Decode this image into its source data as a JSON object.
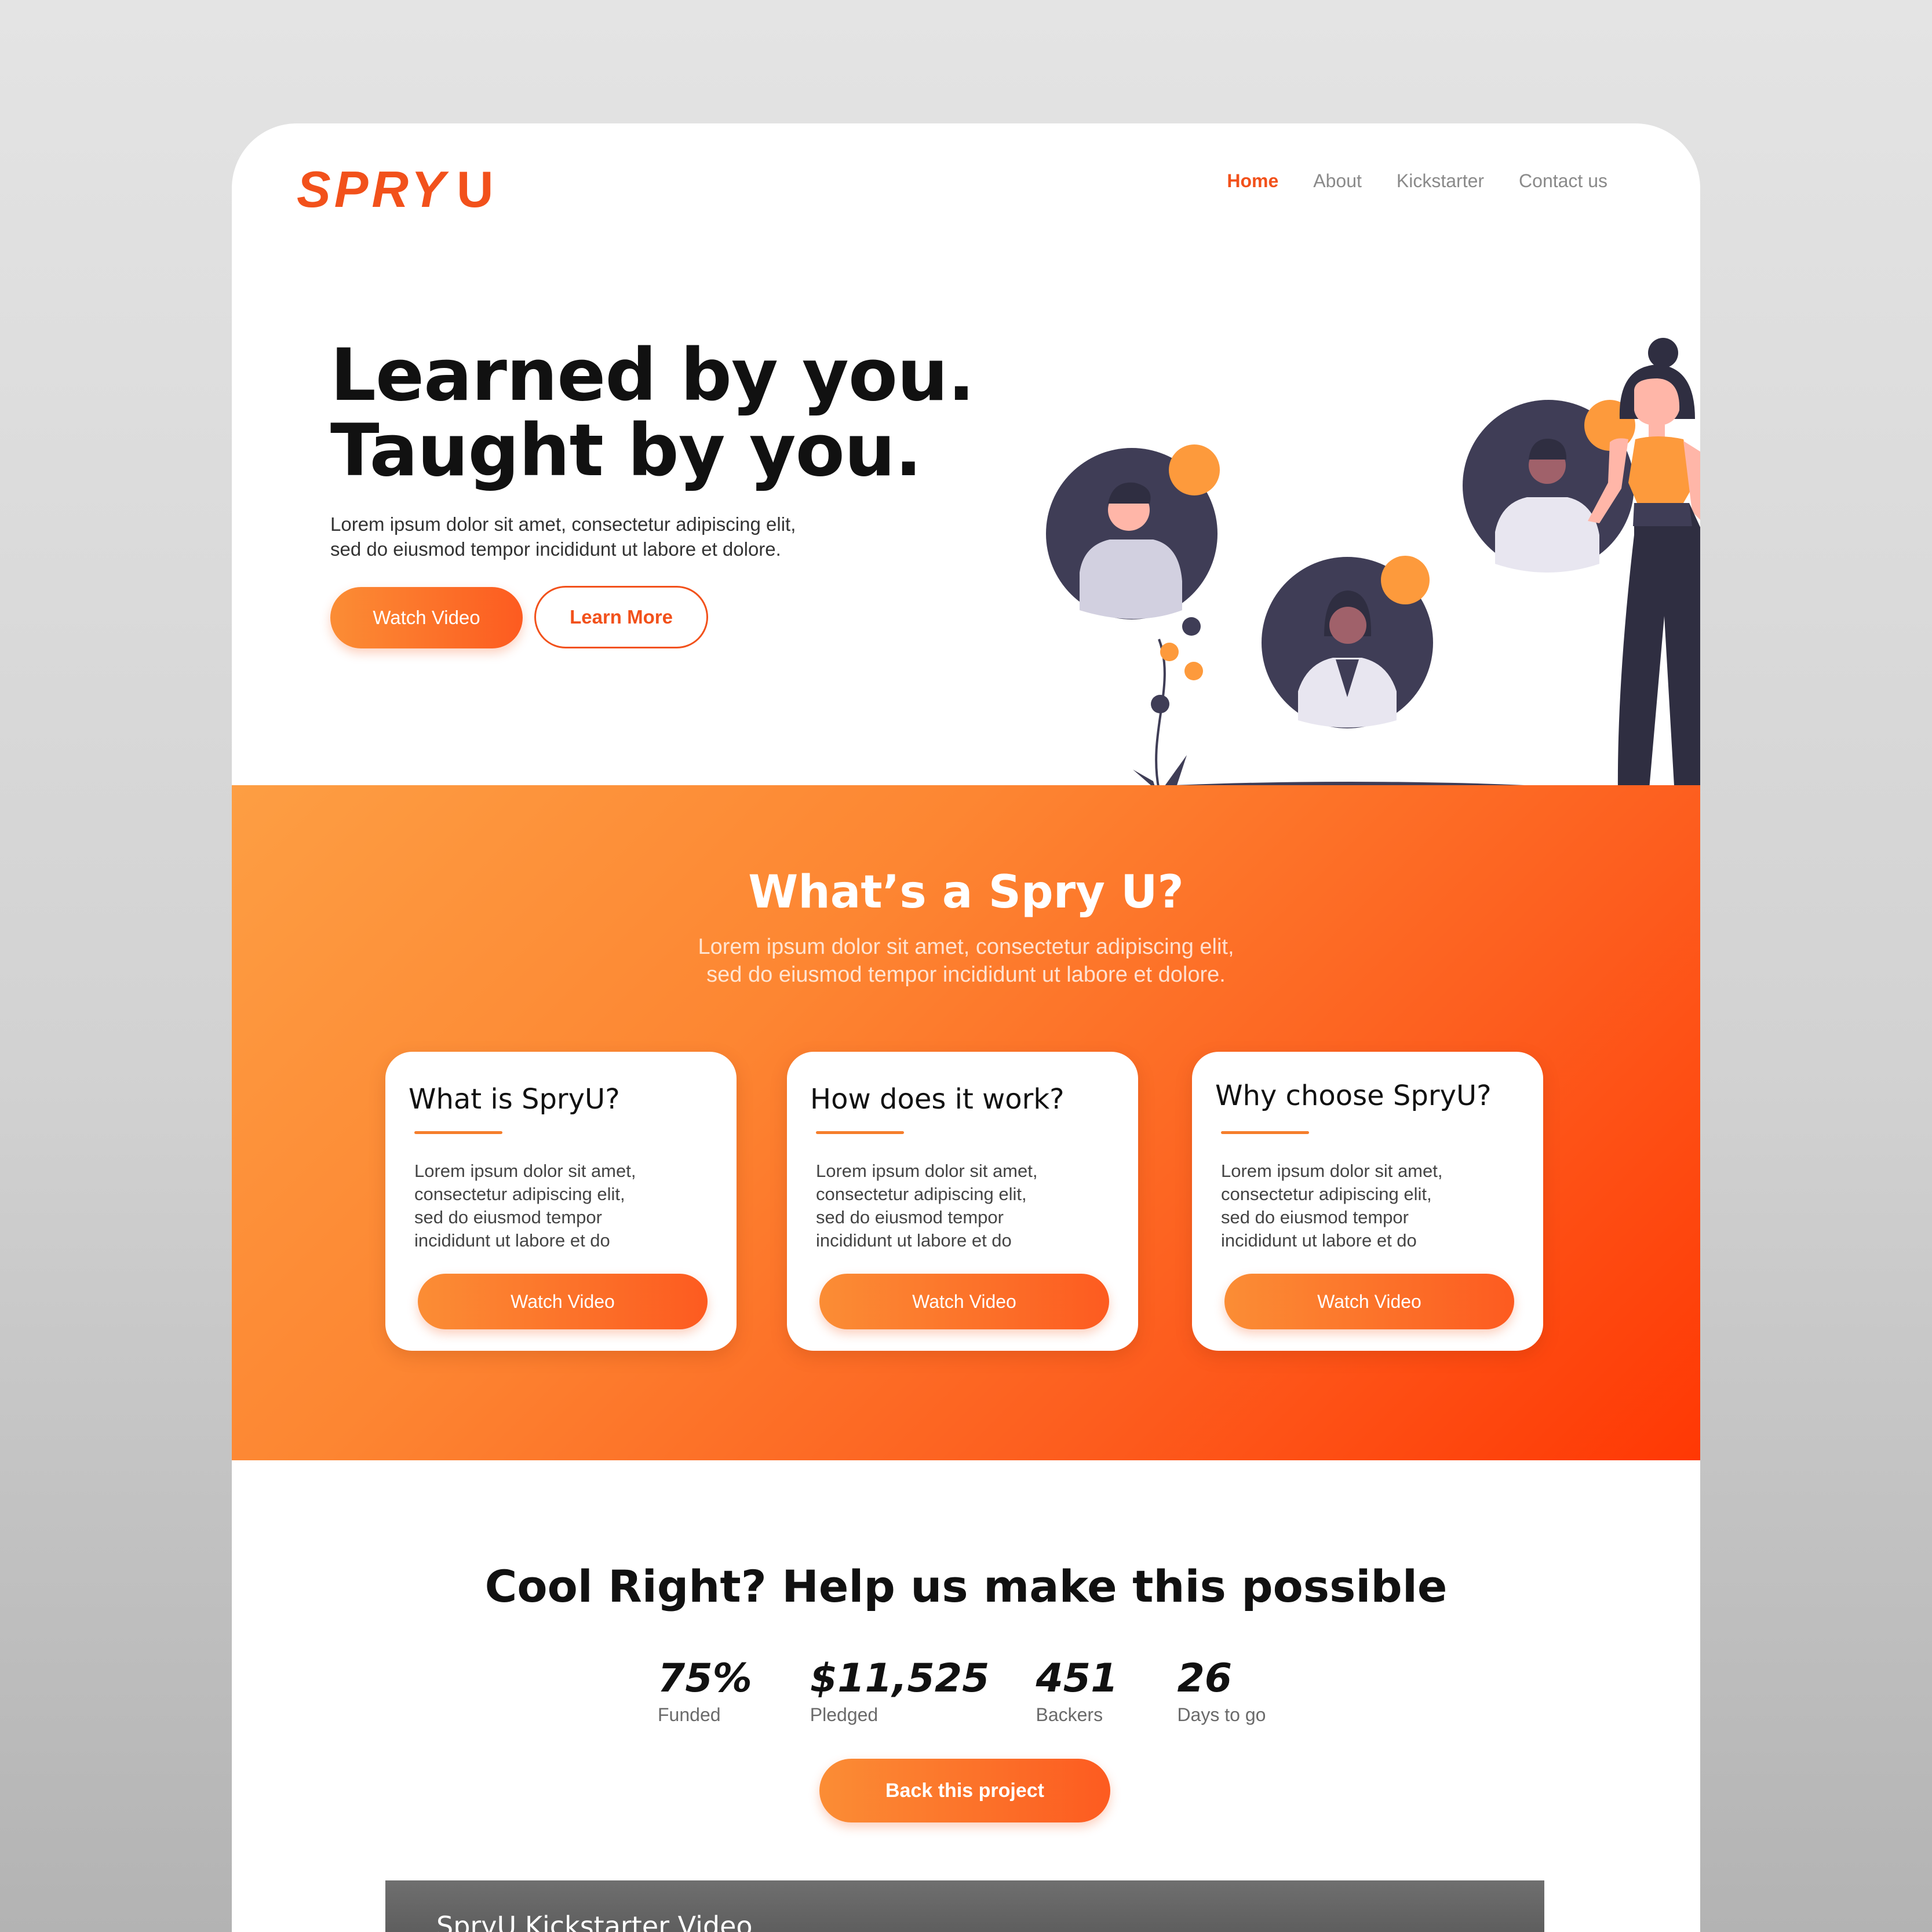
{
  "brand": {
    "logo_main": "SPRY",
    "logo_u": "U",
    "accent": "#f2511b"
  },
  "nav": [
    {
      "label": "Home",
      "active": true
    },
    {
      "label": "About",
      "active": false
    },
    {
      "label": "Kickstarter",
      "active": false
    },
    {
      "label": "Contact us",
      "active": false
    }
  ],
  "hero": {
    "title_line1": "Learned by you.",
    "title_line2": "Taught by you.",
    "desc_line1": "Lorem ipsum dolor sit amet, consectetur adipiscing elit,",
    "desc_line2": "sed do eiusmod tempor incididunt ut labore et dolore.",
    "watch_label": "Watch Video",
    "learn_label": "Learn More"
  },
  "about": {
    "title": "What’s a Spry U?",
    "sub_line1": "Lorem ipsum dolor sit amet, consectetur adipiscing elit,",
    "sub_line2": "sed do eiusmod tempor incididunt ut labore et dolore.",
    "cards": [
      {
        "title": "What is SpryU?",
        "lines": [
          "Lorem ipsum dolor sit amet,",
          "consectetur adipiscing elit,",
          "sed do eiusmod tempor",
          "incididunt ut labore et do"
        ],
        "button": "Watch Video"
      },
      {
        "title": "How does it work?",
        "lines": [
          "Lorem ipsum dolor sit amet,",
          "consectetur adipiscing elit,",
          "sed do eiusmod tempor",
          "incididunt ut labore et do"
        ],
        "button": "Watch Video"
      },
      {
        "title": "Why choose SpryU?",
        "lines": [
          "Lorem ipsum dolor sit amet,",
          "consectetur adipiscing elit,",
          "sed do eiusmod tempor",
          "incididunt ut labore et do"
        ],
        "button": "Watch Video"
      }
    ]
  },
  "funding": {
    "title": "Cool Right? Help us make this possible",
    "stats": [
      {
        "value": "75%",
        "label": "Funded"
      },
      {
        "value": "$11,525",
        "label": "Pledged"
      },
      {
        "value": "451",
        "label": "Backers"
      },
      {
        "value": "26",
        "label": "Days to go"
      }
    ],
    "button": "Back this project"
  },
  "video": {
    "title": "SpryU Kickstarter Video"
  }
}
